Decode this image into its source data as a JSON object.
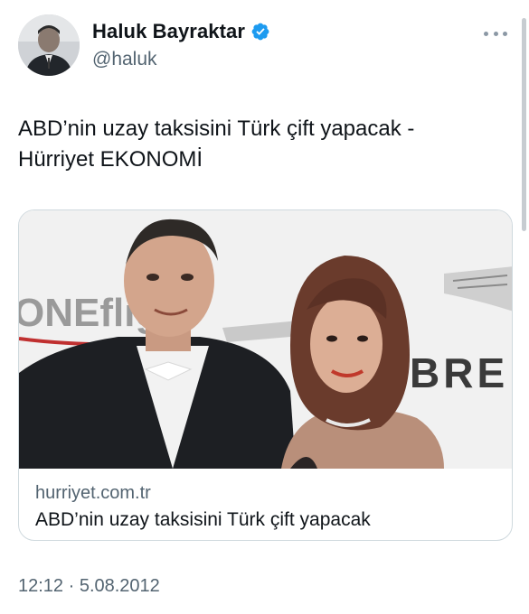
{
  "author": {
    "display_name": "Haluk Bayraktar",
    "handle": "@haluk",
    "verified": true,
    "avatar_icon": "user-avatar"
  },
  "menu_icon": "more-horizontal-icon",
  "tweet": {
    "text": "ABD’nin uzay taksisini Türk çift yapacak -\nHürriyet EKONOMİ"
  },
  "card": {
    "domain": "hurriyet.com.tr",
    "title": "ABD’nin uzay taksisini Türk çift yapacak",
    "image_backdrop_text": {
      "left_logo": "ONEflig",
      "right_logo": "BRE"
    }
  },
  "timestamp": "12:12 · 5.08.2012",
  "colors": {
    "text_primary": "#0f1419",
    "text_secondary": "#536471",
    "verified_blue": "#1d9bf0",
    "border": "#cfd9de"
  }
}
